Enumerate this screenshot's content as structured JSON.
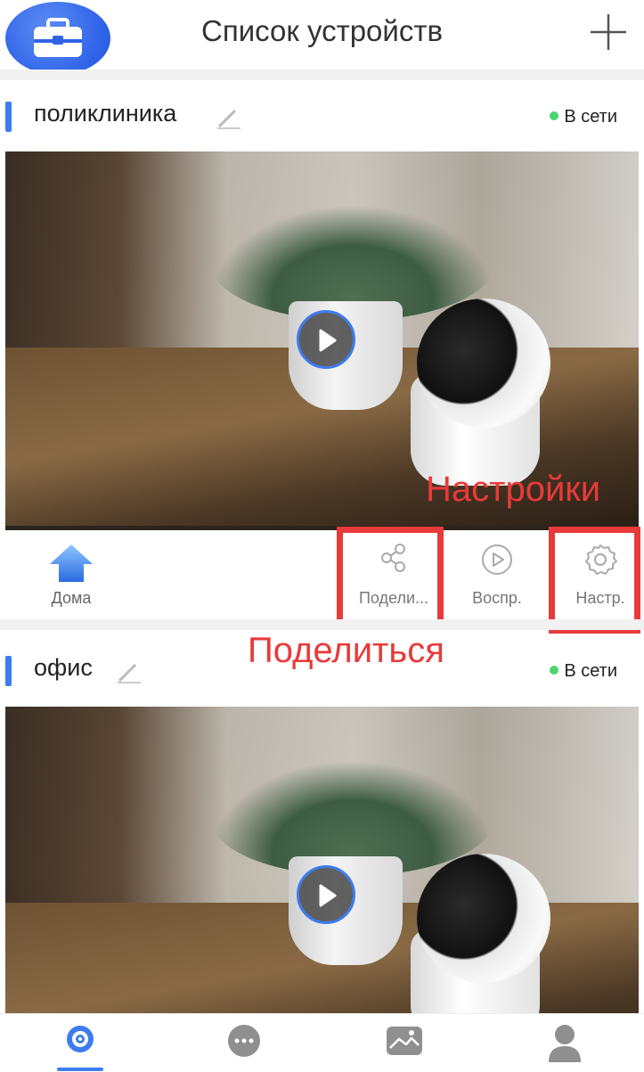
{
  "header": {
    "title": "Список устройств"
  },
  "devices": [
    {
      "name": "поликлиника",
      "status": "В сети",
      "actions": {
        "home": "Дома",
        "share": "Подели...",
        "playback": "Воспр.",
        "settings": "Настр."
      }
    },
    {
      "name": "офис",
      "status": "В сети"
    }
  ],
  "annotations": {
    "settings_label": "Настройки",
    "share_label": "Поделиться"
  },
  "colors": {
    "accent": "#3d7cf0",
    "online": "#4cd471",
    "highlight": "#e83a3a"
  }
}
